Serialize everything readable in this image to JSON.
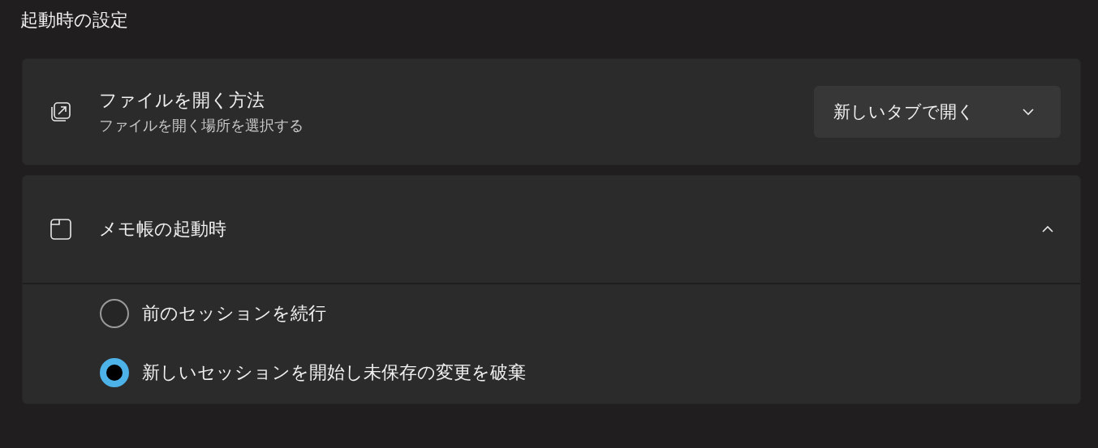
{
  "section_title": "起動時の設定",
  "settings": [
    {
      "kind": "dropdown",
      "title": "ファイルを開く方法",
      "description": "ファイルを開く場所を選択する",
      "value": "新しいタブで開く"
    },
    {
      "kind": "expander",
      "title": "メモ帳の起動時",
      "expanded": true,
      "options": [
        {
          "label": "前のセッションを続行",
          "selected": false
        },
        {
          "label": "新しいセッションを開始し未保存の変更を破棄",
          "selected": true
        }
      ]
    }
  ]
}
